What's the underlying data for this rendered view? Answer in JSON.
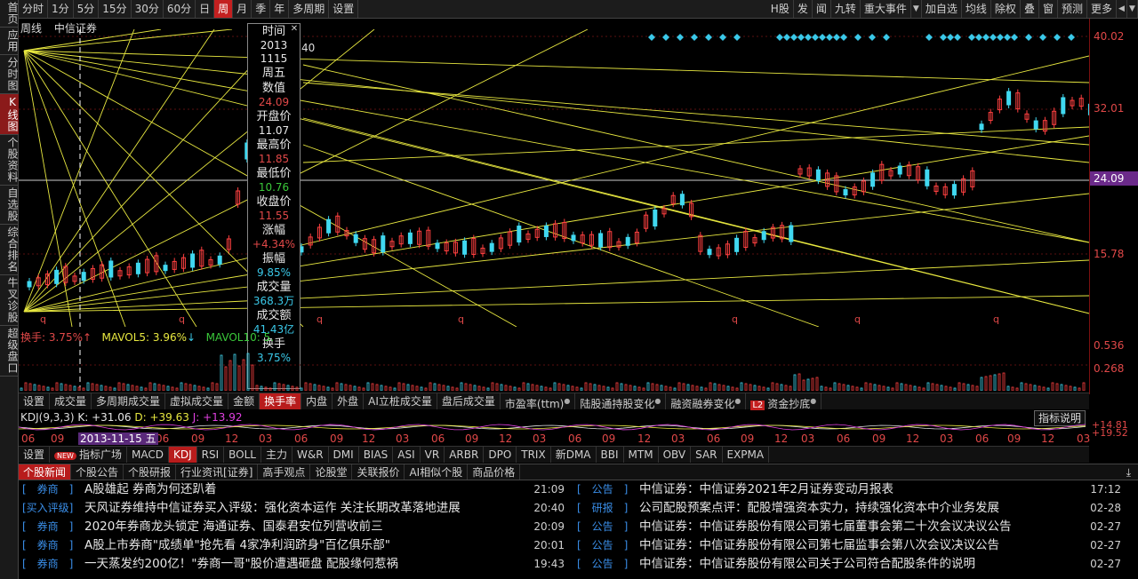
{
  "left_nav": [
    "首页",
    "应用",
    "分时图",
    "K线图",
    "个股资料",
    "自选股",
    "综合排名",
    "牛叉诊股",
    "超级盘口"
  ],
  "left_nav_active": 3,
  "toolbar": {
    "periods": [
      "分时",
      "1分",
      "5分",
      "15分",
      "30分",
      "60分",
      "日",
      "周",
      "月",
      "季",
      "年",
      "多周期",
      "设置"
    ],
    "active_period": 7,
    "right_items": [
      "H股",
      "发",
      "闻",
      "九转",
      "重大事件",
      "加自选",
      "均线",
      "除权",
      "叠",
      "窗",
      "预测",
      "更多"
    ]
  },
  "chart_title": {
    "period": "周线",
    "stock": "中信证券",
    "partial_value": "40"
  },
  "price_axis": {
    "labels": [
      "40.02",
      "32.01",
      "24.09",
      "15.78"
    ],
    "current": "24.09",
    "vol_labels": [
      "0.536",
      "0.268"
    ]
  },
  "data_window": {
    "items": [
      {
        "label": "时间",
        "value": "2013",
        "color": "#e8e8e8"
      },
      {
        "label": "",
        "value": "1115",
        "color": "#e8e8e8"
      },
      {
        "label": "周五",
        "value": "",
        "color": "#e8e8e8"
      },
      {
        "label": "数值",
        "value": "24.09",
        "color": "#e04848"
      },
      {
        "label": "开盘价",
        "value": "11.07",
        "color": "#e8e8e8"
      },
      {
        "label": "最高价",
        "value": "11.85",
        "color": "#e04848"
      },
      {
        "label": "最低价",
        "value": "10.76",
        "color": "#3ac83a"
      },
      {
        "label": "收盘价",
        "value": "11.55",
        "color": "#e04848"
      },
      {
        "label": "涨幅",
        "value": "+4.34%",
        "color": "#e04848"
      },
      {
        "label": "振幅",
        "value": "9.85%",
        "color": "#3ac8e8"
      },
      {
        "label": "成交量",
        "value": "368.3万",
        "color": "#3ac8e8"
      },
      {
        "label": "成交额",
        "value": "41.43亿",
        "color": "#3ac8e8"
      },
      {
        "label": "换手",
        "value": "3.75%",
        "color": "#3ac8e8"
      }
    ]
  },
  "turnover_line": {
    "hs": "换手: 3.75%",
    "mavol5": "MAVOL5: 3.96%",
    "mavol10": "MAVOL10: 5."
  },
  "indicator_tabs": [
    "设置",
    "成交量",
    "多周期成交量",
    "虚拟成交量",
    "金额",
    "换手率",
    "内盘",
    "外盘",
    "AI立桩成交量",
    "盘后成交量",
    "市盈率(ttm)",
    "陆股通持股变化",
    "融资融券变化",
    "资金抄底"
  ],
  "indicator_tabs_active": 5,
  "kdj_line": {
    "name": "KDJ(9,3,3)",
    "k": "K: +31.06",
    "d": "D: +39.63",
    "j": "J: +13.92"
  },
  "indicator_help": "指标说明",
  "kdj_axis": [
    "+14.81",
    "+19.52"
  ],
  "time_axis": {
    "labels": [
      "06",
      "09",
      "06",
      "09",
      "12",
      "03",
      "06",
      "09",
      "12",
      "03",
      "06",
      "09",
      "12",
      "03",
      "06",
      "09",
      "12",
      "03",
      "06",
      "09",
      "12",
      "03",
      "06",
      "09",
      "12",
      "03",
      "06",
      "09",
      "12",
      "03"
    ],
    "highlight": "2013-11-15 五"
  },
  "indicator_tabs2": [
    "设置",
    "指标广场",
    "MACD",
    "KDJ",
    "RSI",
    "BOLL",
    "主力",
    "W&R",
    "DMI",
    "BIAS",
    "ASI",
    "VR",
    "ARBR",
    "DPO",
    "TRIX",
    "新DMA",
    "BBI",
    "MTM",
    "OBV",
    "SAR",
    "EXPMA"
  ],
  "indicator_tabs2_active": 3,
  "new_badge": "NEW",
  "l2_badge": "L2",
  "news_tabs": [
    "个股新闻",
    "个股公告",
    "个股研报",
    "行业资讯[证券]",
    "高手观点",
    "论股堂",
    "关联报价",
    "AI相似个股",
    "商品价格"
  ],
  "news_tabs_active": 0,
  "news_left": [
    {
      "tag": "[　券商　]",
      "title": "A股雄起 券商为何还趴着",
      "time": "21:09"
    },
    {
      "tag": "[买入评级]",
      "title": "天风证券维持中信证券买入评级：强化资本运作 关注长期改革落地进展",
      "time": "20:40"
    },
    {
      "tag": "[　券商　]",
      "title": "2020年券商龙头锁定 海通证券、国泰君安位列营收前三",
      "time": "20:09"
    },
    {
      "tag": "[　券商　]",
      "title": "A股上市券商\"成绩单\"抢先看 4家净利润跻身\"百亿俱乐部\"",
      "time": "20:01"
    },
    {
      "tag": "[　券商　]",
      "title": "一天蒸发约200亿！\"券商一哥\"股价遭遇砸盘 配股缘何惹祸",
      "time": "19:43"
    }
  ],
  "news_right": [
    {
      "tag": "[　公告　]",
      "title": "中信证券：中信证券2021年2月证券变动月报表",
      "time": "17:12"
    },
    {
      "tag": "[　研报　]",
      "title": "公司配股预案点评：配股增强资本实力，持续强化资本中介业务发展",
      "time": "02-28"
    },
    {
      "tag": "[　公告　]",
      "title": "中信证券：中信证券股份有限公司第七届董事会第二十次会议决议公告",
      "time": "02-27"
    },
    {
      "tag": "[　公告　]",
      "title": "中信证券：中信证券股份有限公司第七届监事会第八次会议决议公告",
      "time": "02-27"
    },
    {
      "tag": "[　公告　]",
      "title": "中信证券：中信证券股份有限公司关于公司符合配股条件的说明",
      "time": "02-27"
    }
  ]
}
